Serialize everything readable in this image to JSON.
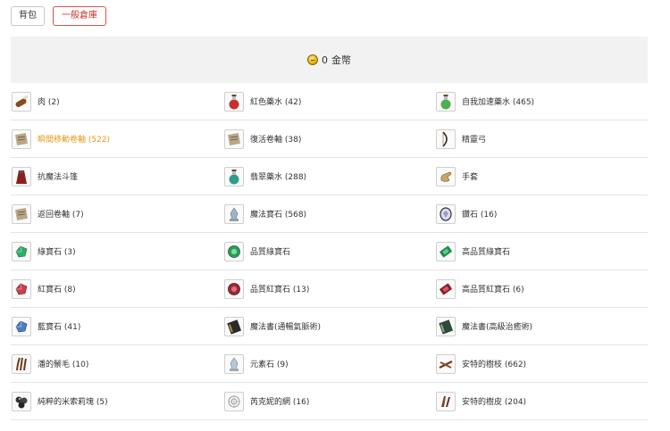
{
  "tabs": [
    {
      "label": "背包",
      "active": false
    },
    {
      "label": "一般倉庫",
      "active": true
    }
  ],
  "gold": {
    "amount": "0",
    "unit": "金幣"
  },
  "items": [
    {
      "name": "肉 (2)",
      "icon": "meat-icon",
      "highlight": false
    },
    {
      "name": "紅色藥水 (42)",
      "icon": "red-potion-icon",
      "highlight": false
    },
    {
      "name": "自我加速藥水 (465)",
      "icon": "green-potion-icon",
      "highlight": false
    },
    {
      "name": "瞬間移動卷軸 (522)",
      "icon": "scroll-icon",
      "highlight": true
    },
    {
      "name": "復活卷軸 (38)",
      "icon": "scroll-icon",
      "highlight": false
    },
    {
      "name": "精靈弓",
      "icon": "bow-icon",
      "highlight": false
    },
    {
      "name": "抗魔法斗篷",
      "icon": "cloak-icon",
      "highlight": false
    },
    {
      "name": "翡翠藥水 (288)",
      "icon": "emerald-potion-icon",
      "highlight": false
    },
    {
      "name": "手套",
      "icon": "glove-icon",
      "highlight": false
    },
    {
      "name": "返回卷軸 (7)",
      "icon": "scroll-icon",
      "highlight": false
    },
    {
      "name": "魔法寶石 (568)",
      "icon": "magic-gem-icon",
      "highlight": false
    },
    {
      "name": "鑽石 (16)",
      "icon": "diamond-icon",
      "highlight": false
    },
    {
      "name": "綠寶石 (3)",
      "icon": "green-gem-icon",
      "highlight": false
    },
    {
      "name": "品質綠寶石",
      "icon": "green-gem-round-icon",
      "highlight": false
    },
    {
      "name": "高品質綠寶石",
      "icon": "green-gem-cut-icon",
      "highlight": false
    },
    {
      "name": "紅寶石 (8)",
      "icon": "red-gem-icon",
      "highlight": false
    },
    {
      "name": "品質紅寶石 (13)",
      "icon": "red-gem-round-icon",
      "highlight": false
    },
    {
      "name": "高品質紅寶石 (6)",
      "icon": "red-gem-cut-icon",
      "highlight": false
    },
    {
      "name": "藍寶石 (41)",
      "icon": "blue-gem-icon",
      "highlight": false
    },
    {
      "name": "魔法書(通暢氣脈術)",
      "icon": "black-book-icon",
      "highlight": false
    },
    {
      "name": "魔法書(高級治癒術)",
      "icon": "green-book-icon",
      "highlight": false
    },
    {
      "name": "潘的鬃毛 (10)",
      "icon": "mane-icon",
      "highlight": false
    },
    {
      "name": "元素石 (9)",
      "icon": "element-stone-icon",
      "highlight": false
    },
    {
      "name": "安特的樹枝 (662)",
      "icon": "branch-icon",
      "highlight": false
    },
    {
      "name": "純粹的米索莉塊 (5)",
      "icon": "mithril-icon",
      "highlight": false
    },
    {
      "name": "芮克妮的網 (16)",
      "icon": "web-icon",
      "highlight": false
    },
    {
      "name": "安特的樹皮 (204)",
      "icon": "bark-icon",
      "highlight": false
    }
  ],
  "colors": {
    "accent": "#d9534f",
    "highlight": "#e39b1d",
    "gold_bar_bg": "#f2f2f2"
  }
}
